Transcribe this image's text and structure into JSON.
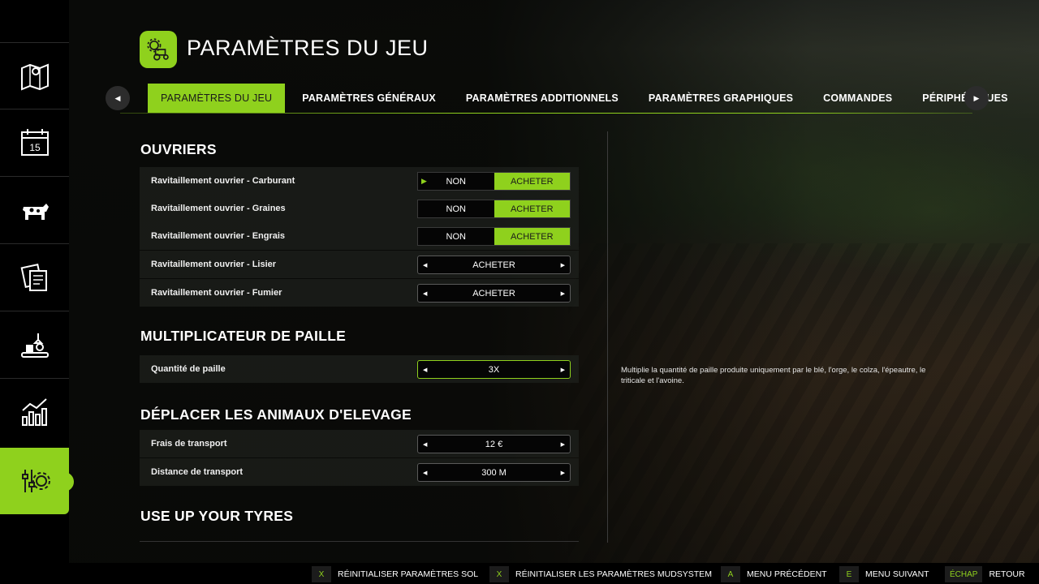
{
  "header": {
    "title": "PARAMÈTRES DU JEU",
    "icon": "tractor-gear-icon"
  },
  "sidebar": {
    "items": [
      {
        "icon": "map-icon",
        "active": false
      },
      {
        "icon": "calendar-icon",
        "label": "15",
        "active": false
      },
      {
        "icon": "cow-icon",
        "active": false
      },
      {
        "icon": "contracts-icon",
        "active": false
      },
      {
        "icon": "production-icon",
        "active": false
      },
      {
        "icon": "statistics-icon",
        "active": false
      },
      {
        "icon": "settings-icon",
        "active": true
      }
    ]
  },
  "tabs": [
    {
      "label": "PARAMÈTRES DU JEU",
      "active": true
    },
    {
      "label": "PARAMÈTRES GÉNÉRAUX",
      "active": false
    },
    {
      "label": "PARAMÈTRES ADDITIONNELS",
      "active": false
    },
    {
      "label": "PARAMÈTRES GRAPHIQUES",
      "active": false
    },
    {
      "label": "COMMANDES",
      "active": false
    },
    {
      "label": "PÉRIPHÉRIQUES",
      "active": false
    }
  ],
  "sections": {
    "workers": {
      "title": "OUVRIERS",
      "rows": [
        {
          "label": "Ravitaillement ouvrier - Carburant",
          "opt_a": "NON",
          "opt_b": "ACHETER",
          "selected": "ACHETER"
        },
        {
          "label": "Ravitaillement ouvrier - Graines",
          "opt_a": "NON",
          "opt_b": "ACHETER",
          "selected": "ACHETER"
        },
        {
          "label": "Ravitaillement ouvrier - Engrais",
          "opt_a": "NON",
          "opt_b": "ACHETER",
          "selected": "ACHETER"
        },
        {
          "label": "Ravitaillement ouvrier - Lisier",
          "value": "ACHETER"
        },
        {
          "label": "Ravitaillement ouvrier - Fumier",
          "value": "ACHETER"
        }
      ]
    },
    "straw": {
      "title": "MULTIPLICATEUR DE PAILLE",
      "rows": [
        {
          "label": "Quantité de paille",
          "value": "3X"
        }
      ]
    },
    "animals": {
      "title": "DÉPLACER LES ANIMAUX D'ELEVAGE",
      "rows": [
        {
          "label": "Frais de transport",
          "value": "12 €"
        },
        {
          "label": "Distance de transport",
          "value": "300 M"
        }
      ]
    },
    "tyres": {
      "title": "USE UP YOUR TYRES"
    }
  },
  "description": "Multiplie la quantité de paille produite uniquement par le blé, l'orge, le colza, l'épeautre, le triticale et l'avoine.",
  "footer": {
    "hints": [
      {
        "key": "X",
        "label": "RÉINITIALISER PARAMÈTRES SOL"
      },
      {
        "key": "X",
        "label": "RÉINITIALISER LES PARAMÈTRES MUDSYSTEM"
      },
      {
        "key": "A",
        "label": "MENU PRÉCÉDENT"
      },
      {
        "key": "E",
        "label": "MENU SUIVANT"
      },
      {
        "key": "ÉCHAP",
        "label": "RETOUR"
      }
    ]
  },
  "colors": {
    "accent": "#8fd11d",
    "panel": "#1e201c",
    "sidebar": "#000000"
  }
}
